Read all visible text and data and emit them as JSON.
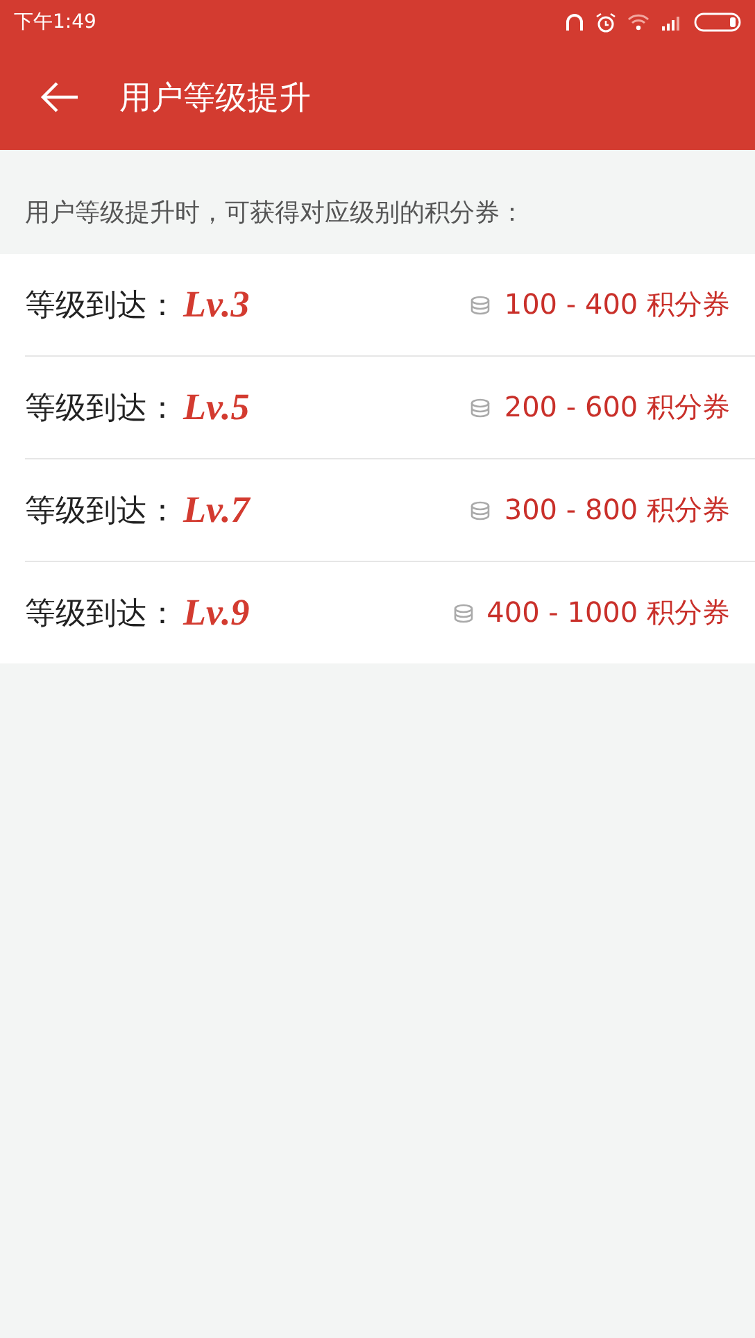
{
  "status_bar": {
    "time": "下午1:49"
  },
  "header": {
    "title": "用户等级提升"
  },
  "intro": "用户等级提升时，可获得对应级别的积分券：",
  "levels": [
    {
      "label": "等级到达：",
      "level": "Lv.3",
      "reward": "100 - 400 积分券"
    },
    {
      "label": "等级到达：",
      "level": "Lv.5",
      "reward": "200 - 600 积分券"
    },
    {
      "label": "等级到达：",
      "level": "Lv.7",
      "reward": "300 - 800 积分券"
    },
    {
      "label": "等级到达：",
      "level": "Lv.9",
      "reward": "400 - 1000 积分券"
    }
  ]
}
